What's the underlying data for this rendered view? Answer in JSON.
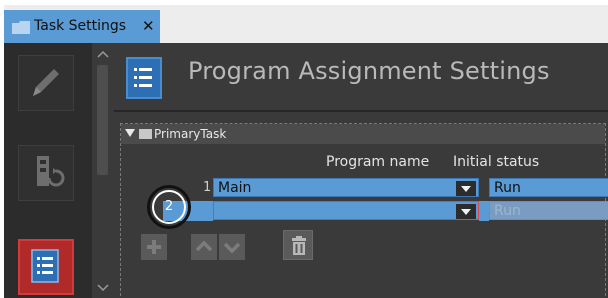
{
  "tab": {
    "title": "Task Settings",
    "close": "✕"
  },
  "header": {
    "title": "Program Assignment Settings"
  },
  "section": {
    "label": "PrimaryTask"
  },
  "columns": {
    "program_name": "Program name",
    "initial_status": "Initial status"
  },
  "rows": [
    {
      "number": "1",
      "program": "Main",
      "status": "Run"
    },
    {
      "number": "2",
      "program": "",
      "status": "Run"
    }
  ],
  "toolbar_icons": [
    "add-icon",
    "move-up-icon",
    "move-down-icon",
    "delete-icon"
  ],
  "sidebar_icons": [
    "pencil-icon",
    "task-settings-icon",
    "program-assignment-icon"
  ],
  "colors": {
    "accent": "#5b9bd5",
    "panel": "#3a3a3a",
    "error_border": "#e04646",
    "active": "#b02a2a"
  }
}
